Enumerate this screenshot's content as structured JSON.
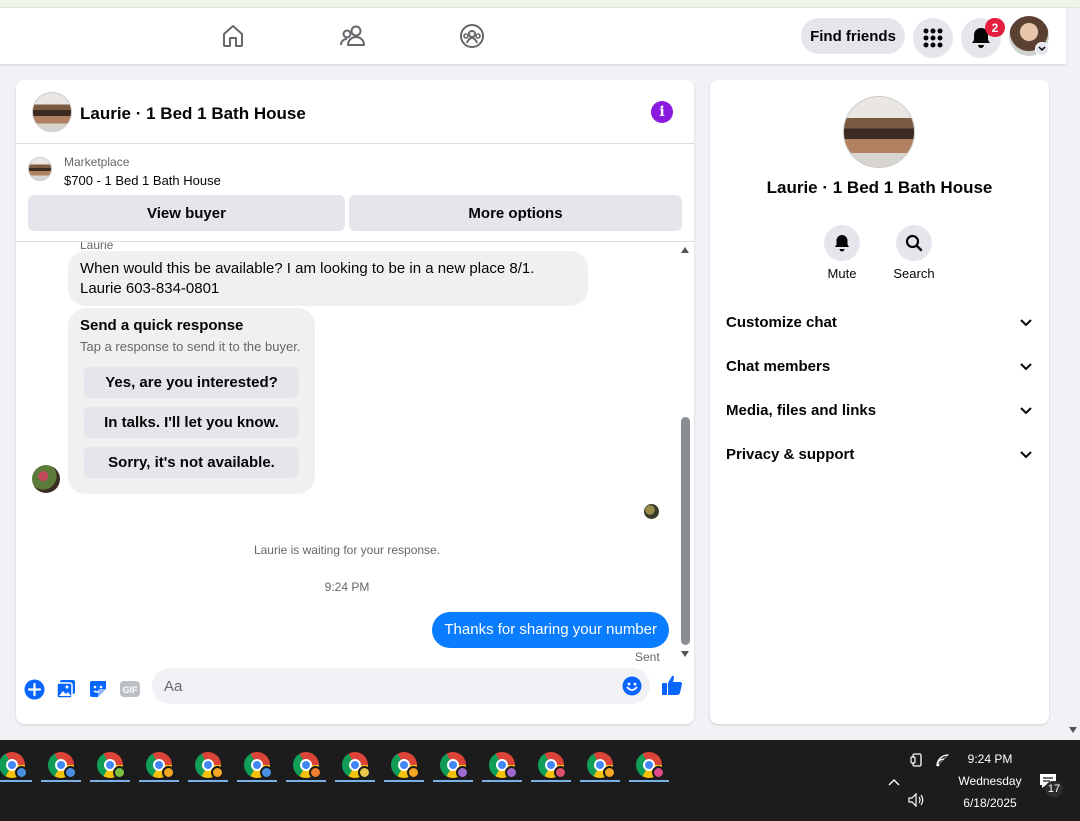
{
  "navbar": {
    "find_friends_label": "Find friends",
    "notification_count": "2",
    "icons": [
      "home-icon",
      "friends-icon",
      "groups-icon",
      "apps-grid-icon",
      "bell-icon",
      "account-avatar"
    ]
  },
  "chat": {
    "title": "Laurie · 1 Bed 1 Bath House",
    "marketplace_label": "Marketplace",
    "listing": "$700 - 1 Bed 1 Bath House",
    "view_buyer_label": "View buyer",
    "more_options_label": "More options",
    "sender_name": "Laurie",
    "incoming_message_line1": "When would this be available? I am looking to be in a new place 8/1.",
    "incoming_message_line2": "Laurie 603-834-0801",
    "quick_response": {
      "title": "Send a quick response",
      "subtitle": "Tap a response to send it to the buyer.",
      "options": [
        "Yes, are you interested?",
        "In talks. I'll let you know.",
        "Sorry, it's not available."
      ]
    },
    "waiting_text": "Laurie is waiting for your response.",
    "timestamp": "9:24 PM",
    "outgoing_message": "Thanks for sharing your number",
    "sent_status": "Sent",
    "composer_placeholder": "Aa"
  },
  "details": {
    "title": "Laurie · 1 Bed 1 Bath House",
    "mute_label": "Mute",
    "search_label": "Search",
    "sections": [
      "Customize chat",
      "Chat members",
      "Media, files and links",
      "Privacy & support"
    ]
  },
  "taskbar": {
    "app_count": 14,
    "time": "9:24 PM",
    "day": "Wednesday",
    "date": "6/18/2025",
    "notification_count": "17",
    "profile_colors": [
      "#4a90e2",
      "#4a90e2",
      "#7ac143",
      "#f5a623",
      "#f5a623",
      "#4a90e2",
      "#f08030",
      "#e6c84a",
      "#f5a623",
      "#a06ad0",
      "#a06ad0",
      "#e0506a",
      "#f5a623",
      "#e04a8a"
    ]
  },
  "colors": {
    "messenger_blue": "#0a7cff",
    "info_purple": "#8a1bde",
    "badge_red": "#e41e3f",
    "facebook_blue": "#0866ff"
  }
}
